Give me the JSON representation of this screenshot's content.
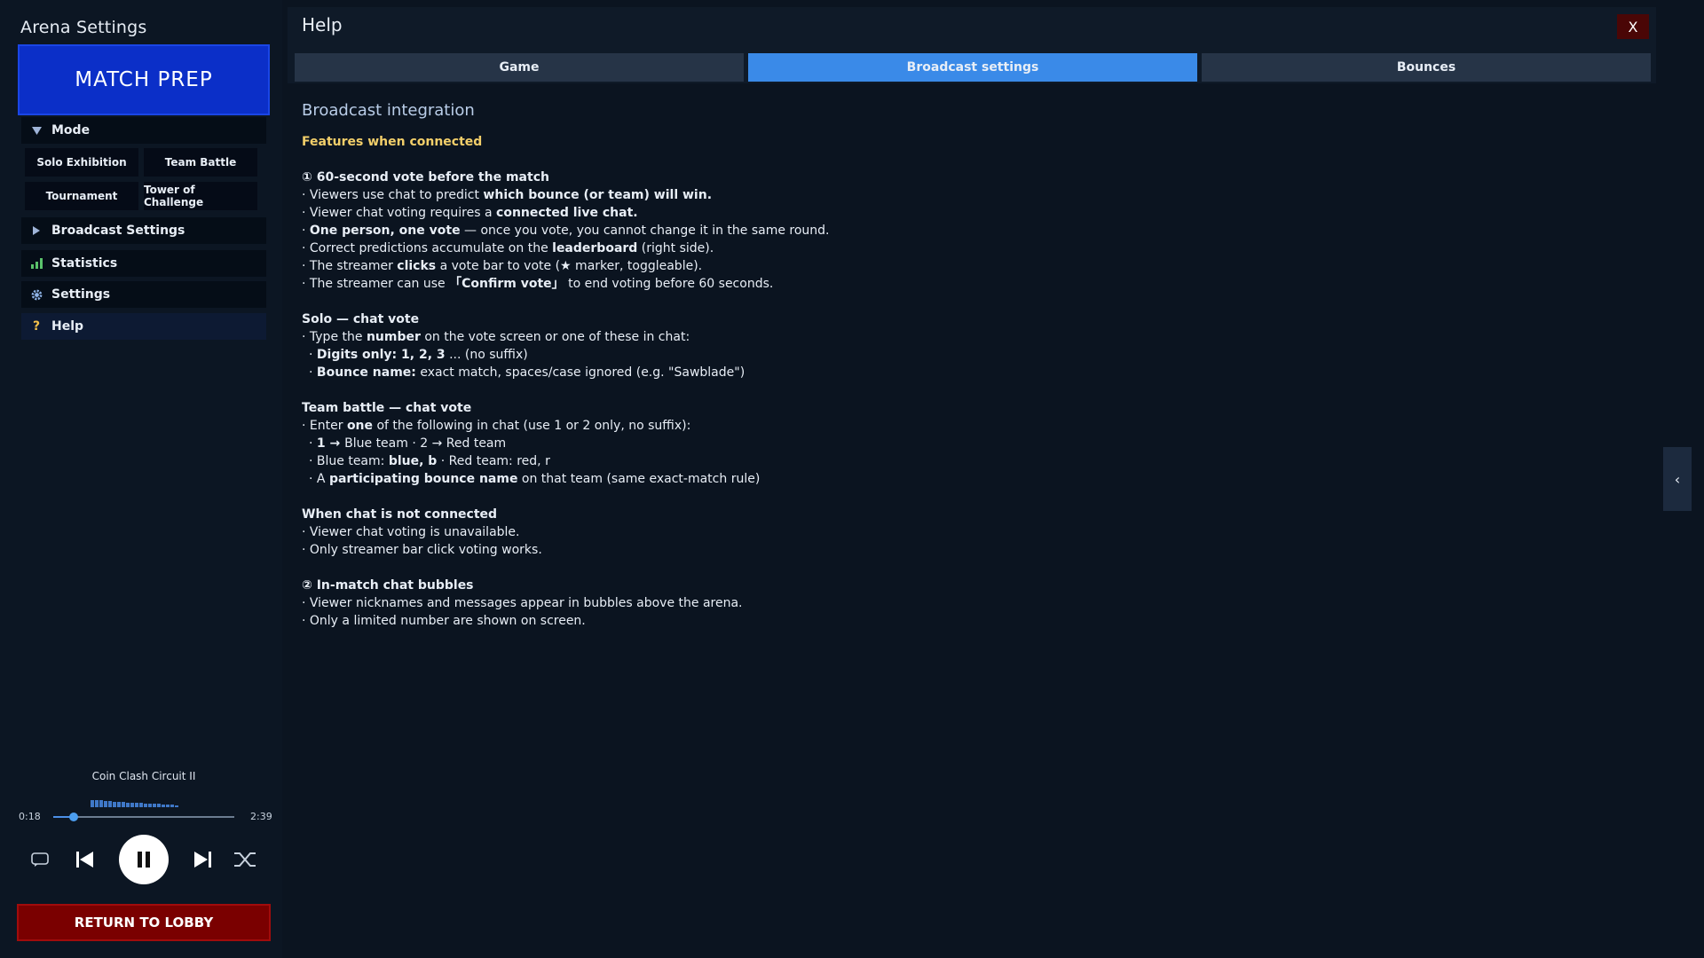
{
  "sidebar": {
    "app_title": "Arena Settings",
    "match_prep_label": "MATCH PREP",
    "mode_section": "Mode",
    "mode_buttons": [
      "Solo Exhibition",
      "Team Battle",
      "Tournament",
      "Tower of Challenge"
    ],
    "broadcast_section": "Broadcast Settings",
    "statistics_section": "Statistics",
    "settings_section": "Settings",
    "help_section": "Help",
    "icons": {
      "mode": "triangle-down-icon",
      "broadcast": "triangle-right-icon",
      "statistics": "bar-chart-icon",
      "settings": "gear-icon",
      "help": "question-icon"
    }
  },
  "player": {
    "track_title": "Coin Clash Circuit II",
    "elapsed": "0:18",
    "duration": "2:39",
    "progress_fraction": 0.113,
    "playing": true,
    "return_label": "RETURN TO LOBBY"
  },
  "help": {
    "title": "Help",
    "close_label": "X",
    "tabs": [
      "Game",
      "Broadcast settings",
      "Bounces"
    ],
    "active_tab": 1,
    "heading": "Broadcast integration",
    "subheading": "Features when connected",
    "vote_title": "① 60-second vote before the match",
    "vote_lines": [
      {
        "pre": "· Viewers use chat to predict ",
        "bold": "which bounce (or team) will win.",
        "post": ""
      },
      {
        "pre": "· Viewer chat voting requires a ",
        "bold": "connected live chat.",
        "post": ""
      },
      {
        "pre": "· ",
        "bold": "One person, one vote",
        "post": " — once you vote, you cannot change it in the same round."
      },
      {
        "pre": "· Correct predictions accumulate on the ",
        "bold": "leaderboard",
        "post": " (right side)."
      },
      {
        "pre": "· The streamer ",
        "bold": "clicks",
        "post": " a vote bar to vote (★ marker, toggleable)."
      },
      {
        "pre": "· The streamer can use ",
        "bold": "「Confirm vote」",
        "post": " to end voting before 60 seconds."
      }
    ],
    "solo_title": "Solo — chat vote",
    "solo_lines": [
      {
        "pre": "· Type the ",
        "bold": "number",
        "post": " on the vote screen or one of these in chat:",
        "sub": false
      },
      {
        "pre": "· ",
        "bold": "Digits only: 1, 2, 3",
        "post": " ... (no suffix)",
        "sub": true
      },
      {
        "pre": "· ",
        "bold": "Bounce name:",
        "post": " exact match, spaces/case ignored (e.g. \"Sawblade\")",
        "sub": true
      }
    ],
    "team_title": "Team battle — chat vote",
    "team_lines": [
      {
        "pre": "· Enter ",
        "bold": "one",
        "post": " of the following in chat (use 1 or 2 only, no suffix):",
        "sub": false
      },
      {
        "pre": "· ",
        "bold": "1 → ",
        "post": "Blue team · 2 → Red team",
        "sub": true
      },
      {
        "pre": "· Blue team: ",
        "bold": "blue, b",
        "post": " · Red team: red, r",
        "sub": true
      },
      {
        "pre": "· A ",
        "bold": "participating bounce name",
        "post": " on that team (same exact-match rule)",
        "sub": true
      }
    ],
    "nochat_title": "When chat is not connected",
    "nochat_lines": [
      "· Viewer chat voting is unavailable.",
      "· Only streamer bar click voting works."
    ],
    "bubbles_title": "② In-match chat bubbles",
    "bubbles_lines": [
      "· Viewer nicknames and messages appear in bubbles above the arena.",
      "· Only a limited number are shown on screen."
    ],
    "side_toggle": "‹"
  },
  "colors": {
    "background": "#0b1420",
    "accent_blue": "#3a8ae8",
    "match_prep_blue": "#0b2fc8",
    "return_red": "#7a0000",
    "highlight_yellow": "#f3cf6a"
  }
}
